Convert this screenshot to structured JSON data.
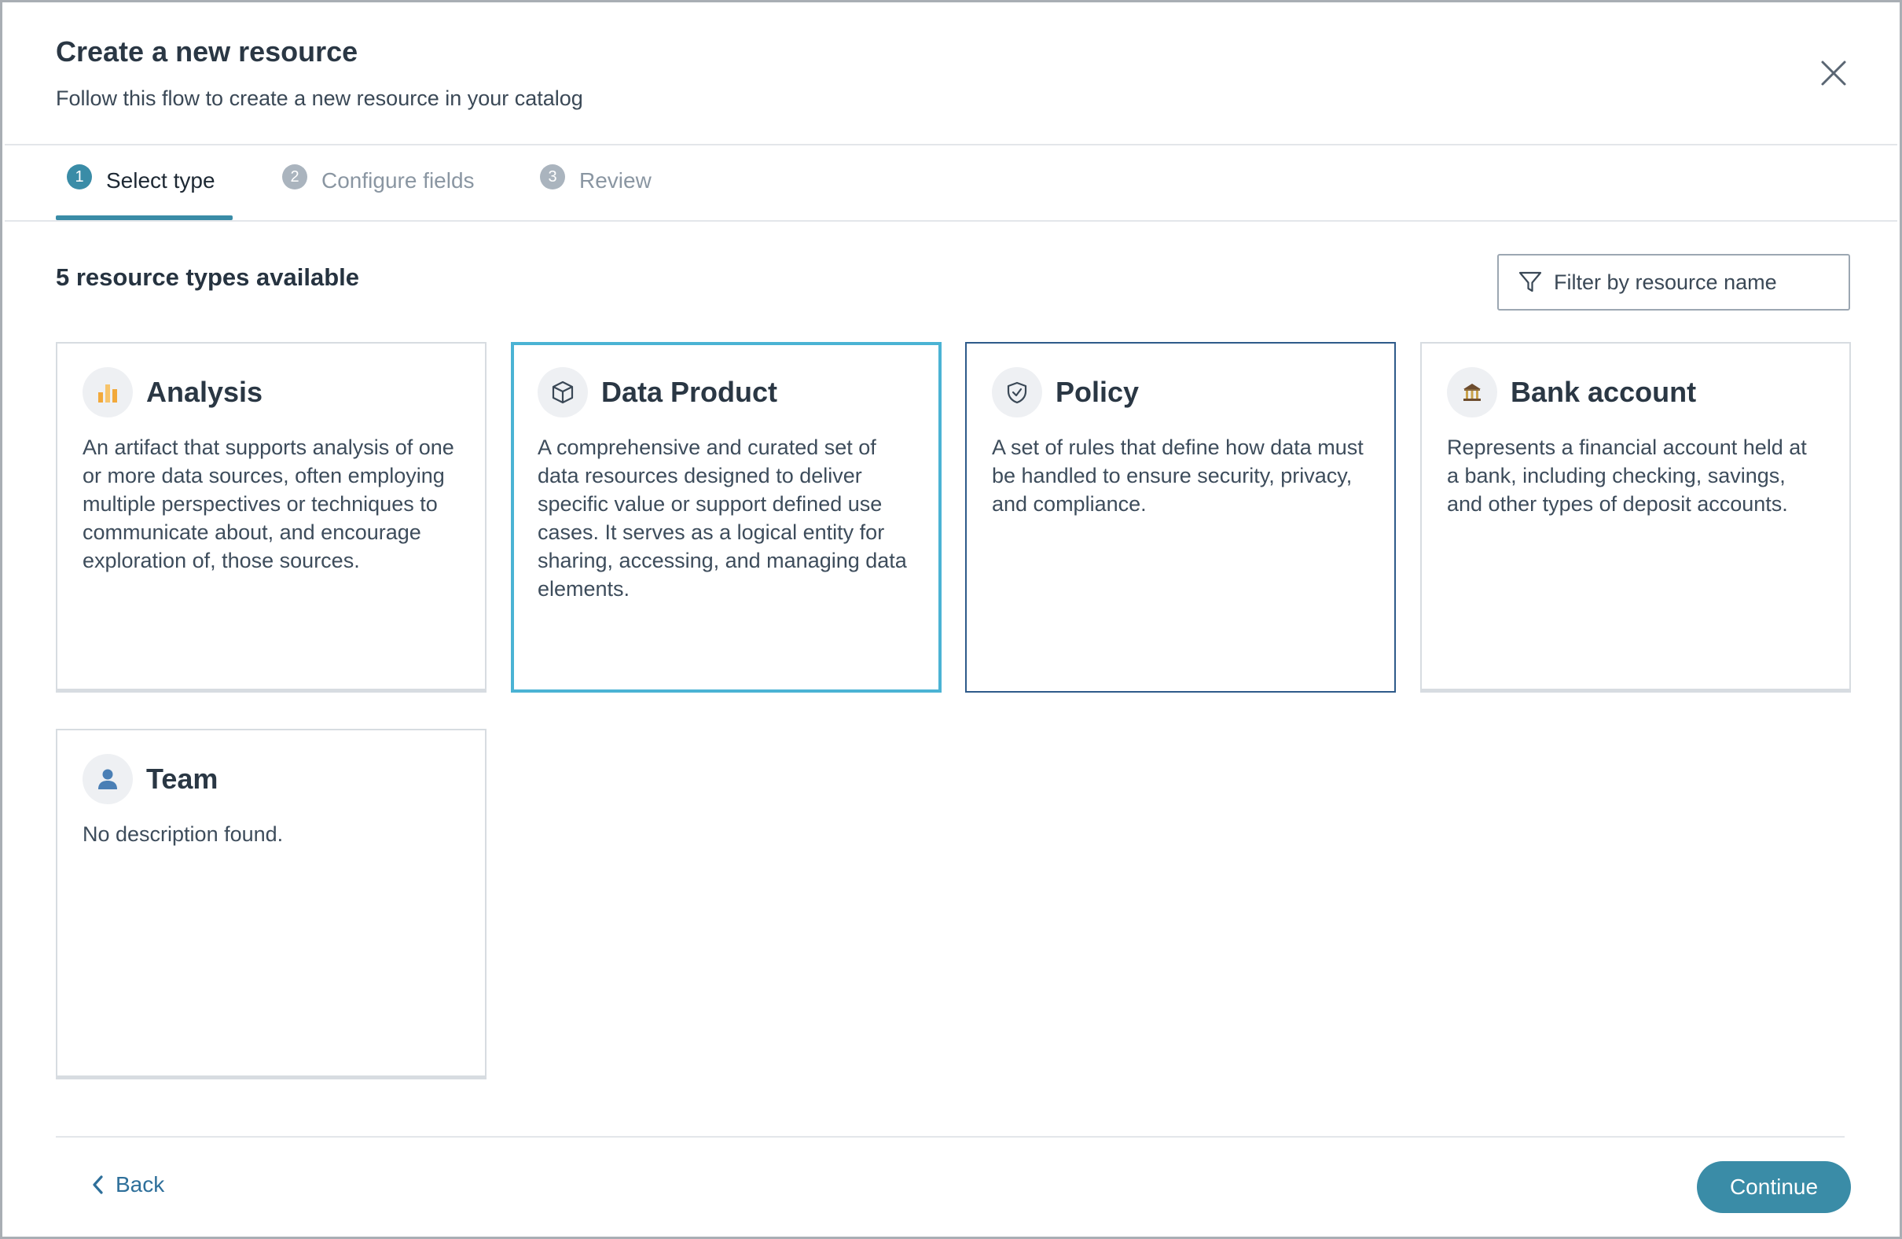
{
  "dialog": {
    "title": "Create a new resource",
    "subtitle": "Follow this flow to create a new resource in your catalog"
  },
  "steps": [
    {
      "number": "1",
      "label": "Select type",
      "state": "active"
    },
    {
      "number": "2",
      "label": "Configure fields",
      "state": "inactive"
    },
    {
      "number": "3",
      "label": "Review",
      "state": "inactive"
    }
  ],
  "content": {
    "count_label": "5 resource types available",
    "filter": {
      "placeholder": "Filter by resource name",
      "value": ""
    }
  },
  "resource_types": [
    {
      "title": "Analysis",
      "icon": "bar-chart-icon",
      "state": "default",
      "description": "An artifact that supports analysis of one or more data sources, often employing multiple perspectives or techniques to communicate about, and encourage exploration of, those sources."
    },
    {
      "title": "Data Product",
      "icon": "cube-icon",
      "state": "selected",
      "description": "A comprehensive and curated set of data resources designed to deliver specific value or support defined use cases. It serves as a logical entity for sharing, accessing, and managing data elements."
    },
    {
      "title": "Policy",
      "icon": "shield-check-icon",
      "state": "hover",
      "description": "A set of rules that define how data must be handled to ensure security, privacy, and compliance."
    },
    {
      "title": "Bank account",
      "icon": "bank-icon",
      "state": "default",
      "description": "Represents a financial account held at a bank, including checking, savings, and other types of deposit accounts."
    },
    {
      "title": "Team",
      "icon": "person-icon",
      "state": "default",
      "description": "No description found."
    }
  ],
  "footer": {
    "back_label": "Back",
    "continue_label": "Continue"
  },
  "colors": {
    "accent": "#3a8ca7",
    "selected_border": "#4bb3d4",
    "hover_border": "#2e5a8a"
  }
}
